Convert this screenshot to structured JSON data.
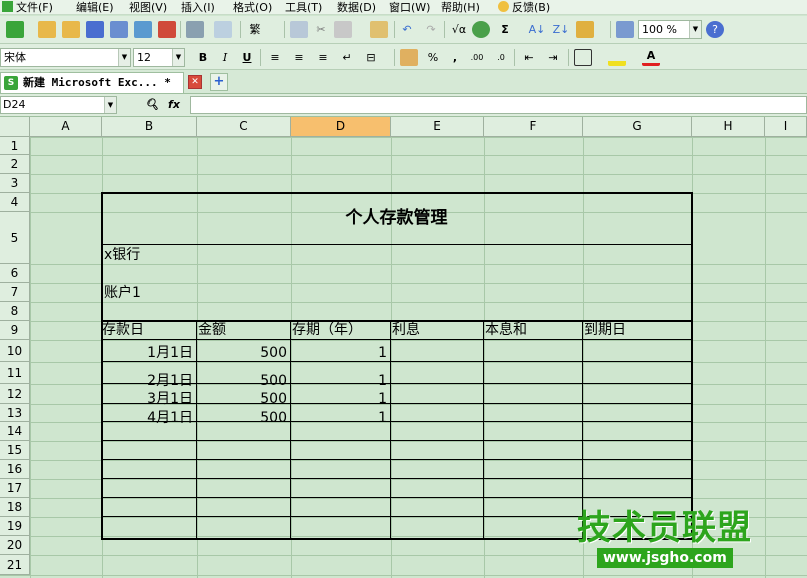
{
  "menubar": {
    "items": [
      "文件(F)",
      "编辑(E)",
      "视图(V)",
      "插入(I)",
      "格式(O)",
      "工具(T)",
      "数据(D)",
      "窗口(W)",
      "帮助(H)",
      "反馈(B)"
    ]
  },
  "toolbar": {
    "zoom": "100 %",
    "font_name": "宋体",
    "font_size": "12",
    "bold": "B",
    "italic": "I",
    "underline": "U",
    "sum": "Σ",
    "percent": "%"
  },
  "tab": {
    "title": "新建 Microsoft Exc... *"
  },
  "formula": {
    "namebox": "D24",
    "fx": "fx"
  },
  "columns": [
    "A",
    "B",
    "C",
    "D",
    "E",
    "F",
    "G",
    "H",
    "I"
  ],
  "rows": [
    "1",
    "2",
    "3",
    "4",
    "5",
    "6",
    "7",
    "8",
    "9",
    "10",
    "11",
    "12",
    "13",
    "14",
    "15",
    "16",
    "17",
    "18",
    "19",
    "20",
    "21"
  ],
  "sheet": {
    "title": "个人存款管理",
    "bank": "x银行",
    "account": "账户1",
    "headers": [
      "存款日",
      "金额",
      "存期（年）",
      "利息",
      "本息和",
      "到期日"
    ],
    "records": [
      {
        "date": "1月1日",
        "amount": "500",
        "term": "1"
      },
      {
        "date": "2月1日",
        "amount": "500",
        "term": "1"
      },
      {
        "date": "3月1日",
        "amount": "500",
        "term": "1"
      },
      {
        "date": "4月1日",
        "amount": "500",
        "term": "1"
      }
    ]
  },
  "watermark": {
    "main": "技术员联盟",
    "url": "www.jsgho.com"
  },
  "colors": {
    "sheet_bg": "#cfe6cf",
    "active_column": "#f7bf6e",
    "watermark": "#2da51d"
  }
}
